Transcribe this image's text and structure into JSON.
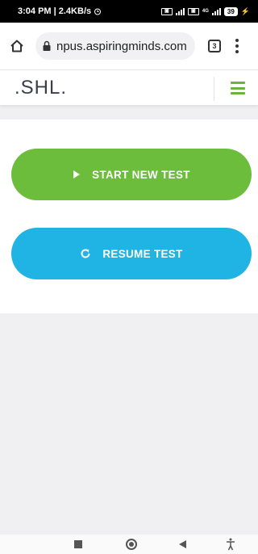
{
  "status_bar": {
    "time_speed": "3:04 PM | 2.4KB/s",
    "alarm_icon": "alarm-icon",
    "sim1": "4G",
    "battery": "39"
  },
  "browser": {
    "url": "npus.aspiringminds.com",
    "tab_count": "3",
    "icons": [
      "home-icon",
      "lock-icon",
      "tabs-icon",
      "more-vert-icon"
    ]
  },
  "site": {
    "logo": ".SHL.",
    "menu_icon": "hamburger-icon",
    "accent": "#6ab33c"
  },
  "actions": {
    "start_label": "START NEW TEST",
    "resume_label": "RESUME TEST",
    "start_color": "#6cbd3c",
    "resume_color": "#1fb4e3"
  },
  "nav": {
    "icons": [
      "recents-icon",
      "home-circle-icon",
      "back-icon",
      "accessibility-icon"
    ]
  }
}
